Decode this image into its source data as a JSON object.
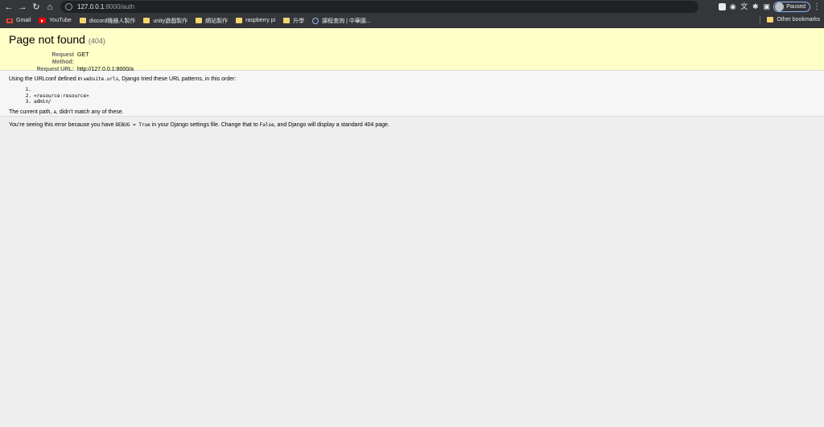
{
  "browser": {
    "url_host": "127.0.0.1",
    "url_rest": ":8000/auth",
    "profile_status": "Paused",
    "bookmarks": [
      {
        "label": "Gmail",
        "icon": "gmail-icon"
      },
      {
        "label": "YouTube",
        "icon": "youtube-icon"
      },
      {
        "label": "discord機器人製作",
        "icon": "folder-icon"
      },
      {
        "label": "unity遊戲製作",
        "icon": "folder-icon"
      },
      {
        "label": "網站製作",
        "icon": "folder-icon"
      },
      {
        "label": "raspberry pi",
        "icon": "folder-icon"
      },
      {
        "label": "升學",
        "icon": "folder-icon"
      },
      {
        "label": "課程查詢 | 中華園...",
        "icon": "globe-icon"
      }
    ],
    "other_bookmarks": "Other bookmarks"
  },
  "error": {
    "title": "Page not found",
    "code": "(404)",
    "request_method_label": "Request Method:",
    "request_method": "GET",
    "request_url_label": "Request URL:",
    "request_url": "http://127.0.0.1:8000/a"
  },
  "info": {
    "intro_before": "Using the URLconf defined in ",
    "urlconf": "website.urls",
    "intro_after": ", Django tried these URL patterns, in this order:",
    "patterns": [
      {
        "num": "1.",
        "pattern": ""
      },
      {
        "num": "2.",
        "pattern": "<resource:resource>"
      },
      {
        "num": "3.",
        "pattern": "admin/"
      }
    ],
    "current_before": "The current path, ",
    "current_path": "a",
    "current_after": ", didn’t match any of these."
  },
  "explanation": {
    "part1": "You’re seeing this error because you have ",
    "code1": "DEBUG = True",
    "part2": " in your Django settings file. Change that to ",
    "code2": "False",
    "part3": ", and Django will display a standard 404 page."
  }
}
